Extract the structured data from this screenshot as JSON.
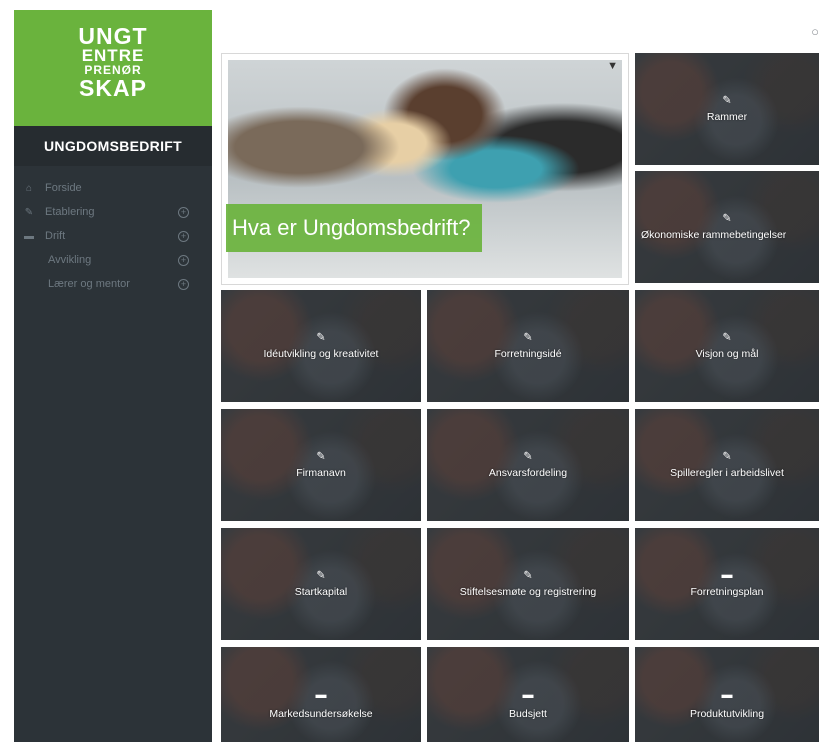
{
  "logo": {
    "line1": "UNGT",
    "line2": "ENTRE",
    "line3": "PRENØR",
    "line4": "SKAP"
  },
  "sidebar": {
    "title": "UNGDOMSBEDRIFT",
    "items": [
      {
        "label": "Forside",
        "icon": "home-icon",
        "expandable": false
      },
      {
        "label": "Etablering",
        "icon": "pencil-icon",
        "expandable": true
      },
      {
        "label": "Drift",
        "icon": "folder-icon",
        "expandable": true
      },
      {
        "label": "Avvikling",
        "icon": "",
        "expandable": true
      },
      {
        "label": "Lærer og mentor",
        "icon": "",
        "expandable": true
      }
    ]
  },
  "hero": {
    "title": "Hva er Ungdomsbedrift?",
    "icon": "pin-icon"
  },
  "tiles": [
    {
      "label": "Rammer",
      "icon": "pencil-icon"
    },
    {
      "label": "Økonomiske rammebetingelser",
      "icon": "pencil-icon"
    },
    {
      "label": "Idéutvikling og kreativitet",
      "icon": "pencil-icon"
    },
    {
      "label": "Forretningsidé",
      "icon": "pencil-icon"
    },
    {
      "label": "Visjon og mål",
      "icon": "pencil-icon"
    },
    {
      "label": "Firmanavn",
      "icon": "pencil-icon"
    },
    {
      "label": "Ansvarsfordeling",
      "icon": "pencil-icon"
    },
    {
      "label": "Spilleregler i arbeidslivet",
      "icon": "pencil-icon"
    },
    {
      "label": "Startkapital",
      "icon": "pencil-icon"
    },
    {
      "label": "Stiftelsesmøte og registrering",
      "icon": "pencil-icon"
    },
    {
      "label": "Forretningsplan",
      "icon": "folder-icon"
    },
    {
      "label": "Markedsundersøkelse",
      "icon": "folder-icon"
    },
    {
      "label": "Budsjett",
      "icon": "folder-icon"
    },
    {
      "label": "Produktutvikling",
      "icon": "folder-icon"
    }
  ],
  "colors": {
    "brand_green": "#6ab33d",
    "sidebar_bg": "#2c3338",
    "sidebar_text": "#6d7880"
  }
}
